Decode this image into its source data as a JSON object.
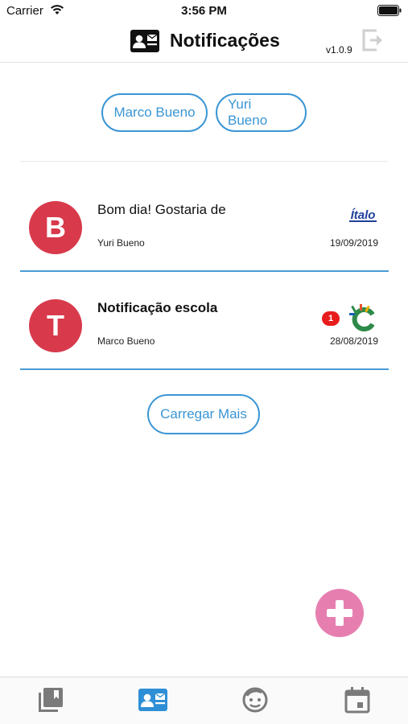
{
  "status_bar": {
    "carrier": "Carrier",
    "time": "3:56 PM"
  },
  "header": {
    "title": "Notificações",
    "version": "v1.0.9",
    "icon": "contact-mail-icon",
    "logout_icon": "logout-icon"
  },
  "filters": [
    {
      "label": "Marco Bueno"
    },
    {
      "label": "Yuri Bueno"
    }
  ],
  "notifications": [
    {
      "initial": "B",
      "title": "Bom dia! Gostaria de",
      "sender": "Yuri Bueno",
      "date": "19/09/2019",
      "logo": "italo-logo",
      "unread_count": null
    },
    {
      "initial": "T",
      "title": "Notificação escola",
      "sender": "Marco Bueno",
      "date": "28/08/2019",
      "logo": "school-c-logo",
      "unread_count": "1"
    }
  ],
  "load_more_label": "Carregar Mais",
  "colors": {
    "accent": "#3a95d4",
    "avatar": "#d83a4c",
    "fab": "#e67fb0",
    "badge": "#e81c1c",
    "tab_active": "#2f8fd6",
    "tab_inactive": "#7a7a7a"
  },
  "tab_bar": [
    {
      "icon": "library-icon",
      "active": false
    },
    {
      "icon": "contact-mail-icon",
      "active": true
    },
    {
      "icon": "child-face-icon",
      "active": false
    },
    {
      "icon": "calendar-icon",
      "active": false
    }
  ]
}
